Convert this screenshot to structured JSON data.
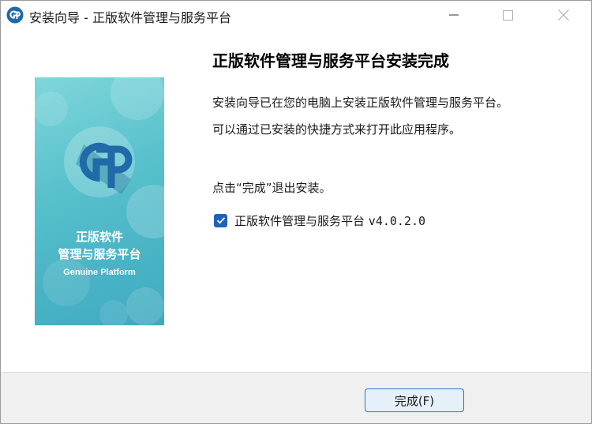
{
  "window": {
    "title": "安装向导 - 正版软件管理与服务平台",
    "controls": [
      "minimize-icon",
      "maximize-icon",
      "close-icon"
    ]
  },
  "banner": {
    "title_line1": "正版软件",
    "title_line2": "管理与服务平台",
    "subtitle": "Genuine Platform"
  },
  "content": {
    "heading": "正版软件管理与服务平台安装完成",
    "line1": "安装向导已在您的电脑上安装正版软件管理与服务平台。",
    "line2": "可以通过已安装的快捷方式来打开此应用程序。",
    "line3": "点击“完成”退出安装。",
    "checkbox": {
      "checked": true,
      "label": "正版软件管理与服务平台",
      "version": "v4.0.2.0"
    }
  },
  "footer": {
    "finish_label": "完成(F)"
  },
  "colors": {
    "accent": "#1f62b8",
    "banner_teal": "#55bfcb",
    "footer_bg": "#f0f0f0"
  }
}
